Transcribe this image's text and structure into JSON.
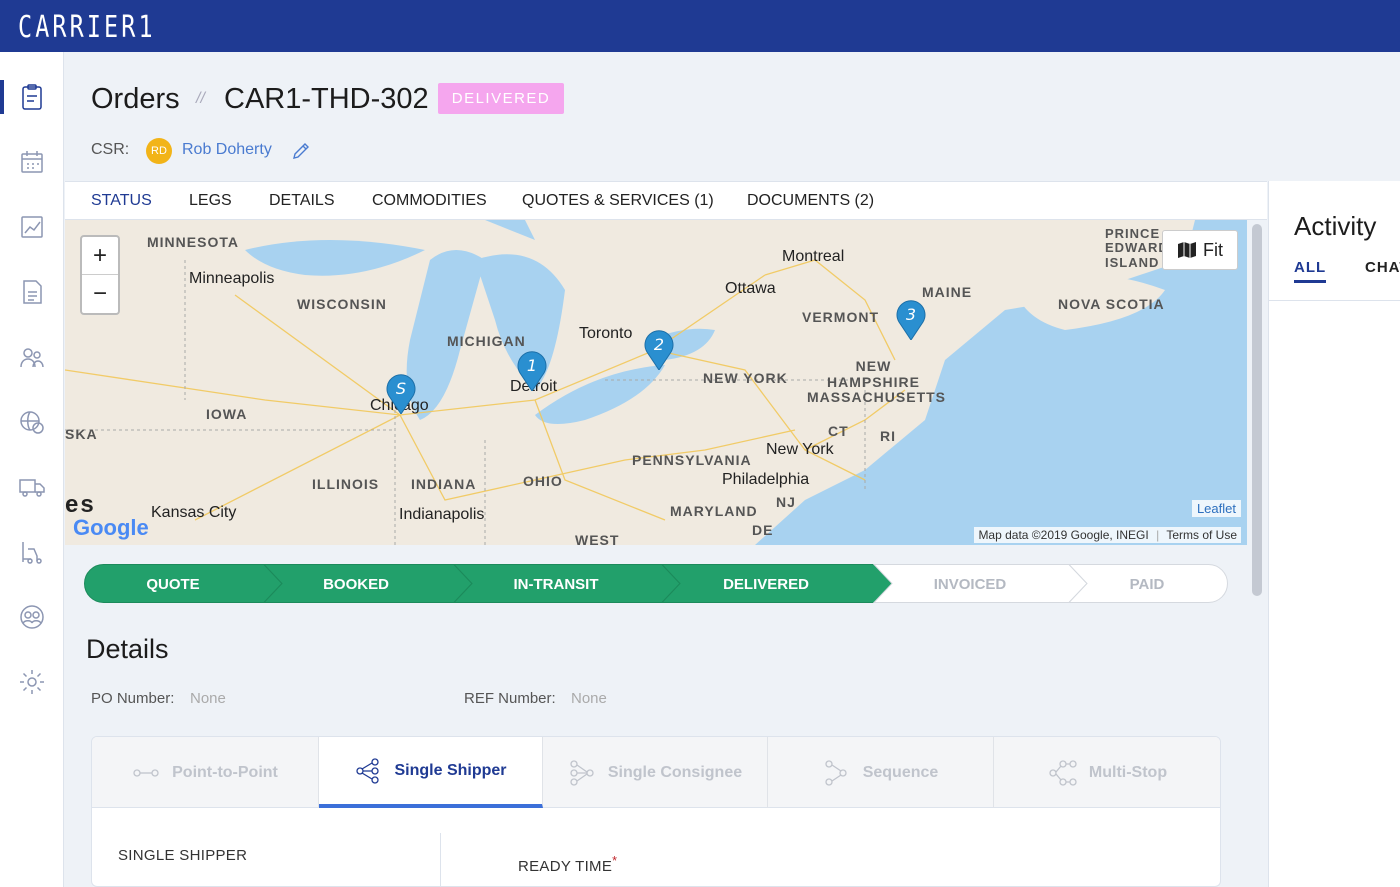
{
  "app": {
    "logo": "CARRIER1"
  },
  "sidebar": {
    "items": [
      {
        "icon": "clipboard-icon",
        "active": true
      },
      {
        "icon": "calendar-icon"
      },
      {
        "icon": "chart-icon"
      },
      {
        "icon": "invoice-icon"
      },
      {
        "icon": "users-icon"
      },
      {
        "icon": "globe-dollar-icon"
      },
      {
        "icon": "truck-icon"
      },
      {
        "icon": "forklift-icon"
      },
      {
        "icon": "contacts-icon"
      },
      {
        "icon": "gear-icon"
      }
    ]
  },
  "header": {
    "title": "Orders",
    "separator": "//",
    "order_id": "CAR1-THD-302",
    "status": "DELIVERED",
    "csr_label": "CSR:",
    "csr_initials": "RD",
    "csr_name": "Rob Doherty"
  },
  "tabs": [
    {
      "label": "STATUS",
      "active": true
    },
    {
      "label": "LEGS"
    },
    {
      "label": "DETAILS"
    },
    {
      "label": "COMMODITIES"
    },
    {
      "label": "QUOTES & SERVICES (1)"
    },
    {
      "label": "DOCUMENTS (2)"
    }
  ],
  "map": {
    "zoom_in": "+",
    "zoom_out": "−",
    "fit_label": "Fit",
    "attribution_leaflet": "Leaflet",
    "attribution_data": "Map data ©2019 Google, INEGI",
    "terms": "Terms of Use",
    "google": "Google",
    "regions": [
      "MINNESOTA",
      "WISCONSIN",
      "MICHIGAN",
      "IOWA",
      "ILLINOIS",
      "INDIANA",
      "OHIO",
      "PENNSYLVANIA",
      "NEW YORK",
      "VERMONT",
      "NEW HAMPSHIRE",
      "MAINE",
      "MASSACHUSETTS",
      "CT",
      "RI",
      "NJ",
      "MARYLAND",
      "NOVA SCOTIA",
      "PRINCE EDWARD ISLAND",
      "SKA",
      "DE",
      "WEST"
    ],
    "cities": [
      "Minneapolis",
      "Chicago",
      "Detroit",
      "Toronto",
      "Ottawa",
      "Montreal",
      "Kansas City",
      "Indianapolis",
      "New York",
      "Philadelphia",
      "es"
    ],
    "pins": [
      "S",
      "1",
      "2",
      "3"
    ]
  },
  "pipeline": [
    {
      "label": "QUOTE",
      "done": true
    },
    {
      "label": "BOOKED",
      "done": true
    },
    {
      "label": "IN-TRANSIT",
      "done": true
    },
    {
      "label": "DELIVERED",
      "done": true
    },
    {
      "label": "INVOICED",
      "done": false
    },
    {
      "label": "PAID",
      "done": false
    }
  ],
  "details": {
    "title": "Details",
    "po_label": "PO Number:",
    "po_value": "None",
    "ref_label": "REF Number:",
    "ref_value": "None"
  },
  "modes": [
    {
      "label": "Point-to-Point",
      "icon": "point-to-point-icon"
    },
    {
      "label": "Single Shipper",
      "icon": "single-shipper-icon",
      "active": true
    },
    {
      "label": "Single Consignee",
      "icon": "single-consignee-icon"
    },
    {
      "label": "Sequence",
      "icon": "sequence-icon"
    },
    {
      "label": "Multi-Stop",
      "icon": "multi-stop-icon"
    }
  ],
  "mode_panel": {
    "shipper_label": "SINGLE SHIPPER",
    "ready_time_label": "READY TIME",
    "required_mark": "*"
  },
  "activity": {
    "title": "Activity",
    "tabs": [
      "ALL",
      "CHAT"
    ]
  },
  "colors": {
    "brand": "#1f3a93",
    "status_pill": "#f5a6ee",
    "pipeline_done": "#22a06b",
    "map_pin": "#2a8fd0",
    "water": "#a8d2f0"
  }
}
